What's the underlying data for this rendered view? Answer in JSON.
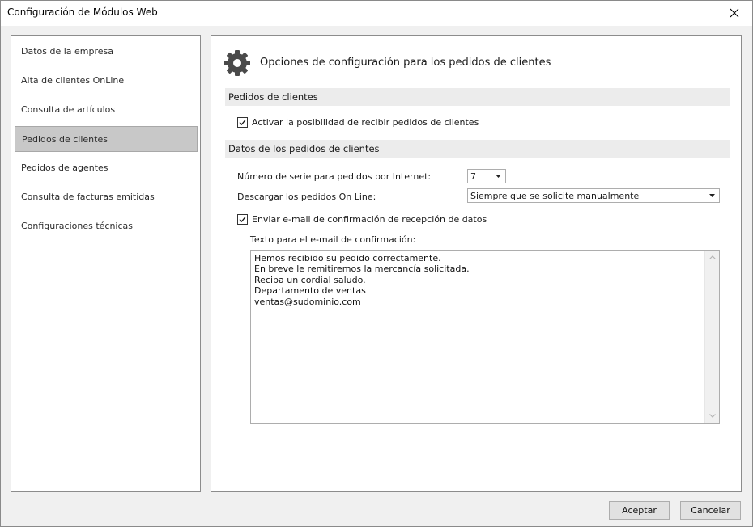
{
  "window": {
    "title": "Configuración de Módulos Web"
  },
  "sidebar": {
    "items": [
      {
        "label": "Datos de la empresa"
      },
      {
        "label": "Alta de clientes OnLine"
      },
      {
        "label": "Consulta de artículos"
      },
      {
        "label": "Pedidos de clientes",
        "selected": true
      },
      {
        "label": "Pedidos de agentes"
      },
      {
        "label": "Consulta de facturas emitidas"
      },
      {
        "label": "Configuraciones técnicas"
      }
    ]
  },
  "main": {
    "header_title": "Opciones de configuración para los pedidos de clientes",
    "header_icon": "gear-icon",
    "section1": {
      "title": "Pedidos de clientes",
      "activate_label": "Activar la posibilidad de recibir pedidos de clientes",
      "activate_checked": true
    },
    "section2": {
      "title": "Datos de los pedidos de clientes",
      "serial_label": "Número de serie para pedidos por Internet:",
      "serial_value": "7",
      "download_label": "Descargar los pedidos On Line:",
      "download_value": "Siempre que se solicite manualmente",
      "email_label": "Enviar e-mail de confirmación de recepción de datos",
      "email_checked": true,
      "text_label": "Texto para el e-mail de confirmación:",
      "text_lines": "Hemos recibido su pedido correctamente.\nEn breve le remitiremos la mercancía solicitada.\nReciba un cordial saludo.\nDepartamento de ventas\nventas@sudominio.com"
    }
  },
  "footer": {
    "ok_label": "Aceptar",
    "cancel_label": "Cancelar"
  }
}
